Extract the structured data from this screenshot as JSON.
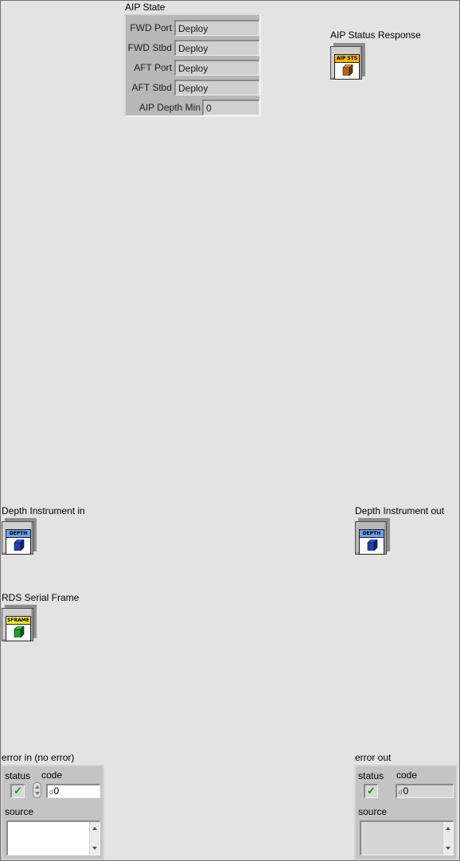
{
  "aip_state": {
    "label": "AIP State",
    "fwd_port": {
      "label": "FWD Port",
      "value": "Deploy"
    },
    "fwd_stbd": {
      "label": "FWD Stbd",
      "value": "Deploy"
    },
    "aft_port": {
      "label": "AFT Port",
      "value": "Deploy"
    },
    "aft_stbd": {
      "label": "AFT Stbd",
      "value": "Deploy"
    },
    "depth_min": {
      "label": "AIP Depth Min",
      "value": "0"
    }
  },
  "aip_status_response": {
    "label": "AIP Status Response",
    "banner": "AIP STS",
    "banner_color": "#f5b800",
    "cube_color": "#b5661a"
  },
  "depth_in": {
    "label": "Depth Instrument in",
    "banner": "DEPTH",
    "banner_color": "#6aa0f0",
    "cube_color": "#1d3fb0"
  },
  "depth_out": {
    "label": "Depth Instrument out",
    "banner": "DEPTH",
    "banner_color": "#6aa0f0",
    "cube_color": "#1d3fb0"
  },
  "rds_serial_frame": {
    "label": "RDS Serial Frame",
    "banner": "SFRAME",
    "banner_color": "#f7e83a",
    "cube_color": "#1a9e2a"
  },
  "error_in": {
    "label": "error in (no error)",
    "status_label": "status",
    "code_label": "code",
    "code_value": "0",
    "source_label": "source",
    "radix": "d",
    "status_icon": "check-icon"
  },
  "error_out": {
    "label": "error out",
    "status_label": "status",
    "code_label": "code",
    "code_value": "0",
    "source_label": "source",
    "radix": "d",
    "status_icon": "check-icon"
  }
}
